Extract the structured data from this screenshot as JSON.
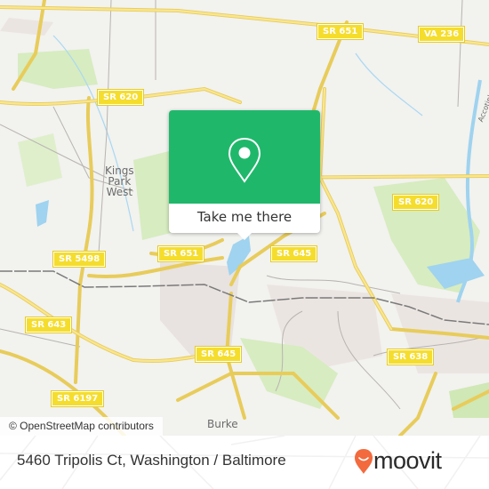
{
  "map": {
    "road_shields": [
      {
        "id": "sr651-top",
        "label": "SR 651"
      },
      {
        "id": "va236",
        "label": "VA 236"
      },
      {
        "id": "sr620-left",
        "label": "SR 620"
      },
      {
        "id": "sr620-right",
        "label": "SR 620"
      },
      {
        "id": "sr5498",
        "label": "SR 5498"
      },
      {
        "id": "sr651-mid",
        "label": "SR 651"
      },
      {
        "id": "sr645-mid",
        "label": "SR 645"
      },
      {
        "id": "sr643",
        "label": "SR 643"
      },
      {
        "id": "sr645-low",
        "label": "SR 645"
      },
      {
        "id": "sr638",
        "label": "SR 638"
      },
      {
        "id": "sr6197",
        "label": "SR 6197"
      }
    ],
    "places": [
      {
        "label": "Kings\nPark\nWest"
      },
      {
        "label": "Burke"
      }
    ],
    "water_labels": [
      {
        "label": "Accotink Creek"
      }
    ],
    "colors": {
      "background": "#f2f2ef",
      "road": "#f7e07a",
      "park": "#d7ecc0",
      "water": "#9fd3ef",
      "rail": "#7a7a7a",
      "residential": "#e8e2e0"
    }
  },
  "popup": {
    "button_label": "Take me there",
    "icon": "map-pin-icon",
    "color": "#1fb86a"
  },
  "attribution": "© OpenStreetMap contributors",
  "footer": {
    "address": "5460 Tripolis Ct, Washington / Baltimore",
    "brand": "moovit",
    "brand_color": "#f26a3d"
  }
}
